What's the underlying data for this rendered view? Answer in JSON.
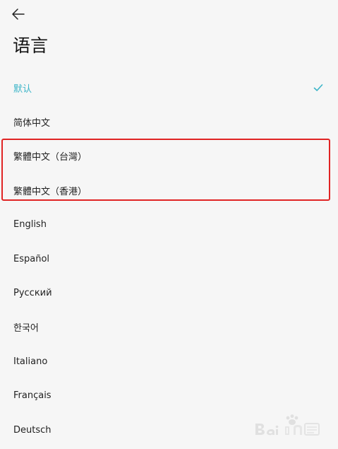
{
  "header": {
    "back_icon": "arrow-left-icon",
    "title": "语言"
  },
  "languages": [
    {
      "label": "默认",
      "selected": true
    },
    {
      "label": "简体中文",
      "selected": false
    },
    {
      "label": "繁體中文（台灣）",
      "selected": false
    },
    {
      "label": "繁體中文（香港）",
      "selected": false
    },
    {
      "label": "English",
      "selected": false
    },
    {
      "label": "Español",
      "selected": false
    },
    {
      "label": "Русский",
      "selected": false
    },
    {
      "label": "한국어",
      "selected": false
    },
    {
      "label": "Italiano",
      "selected": false
    },
    {
      "label": "Français",
      "selected": false
    },
    {
      "label": "Deutsch",
      "selected": false
    }
  ],
  "colors": {
    "accent": "#3cb5c8",
    "highlight_border": "#e02424",
    "background": "#f6f6f6"
  },
  "icons": {
    "selected_check": "check-icon"
  },
  "watermark": {
    "logo": "baidu-jingyan-logo"
  }
}
